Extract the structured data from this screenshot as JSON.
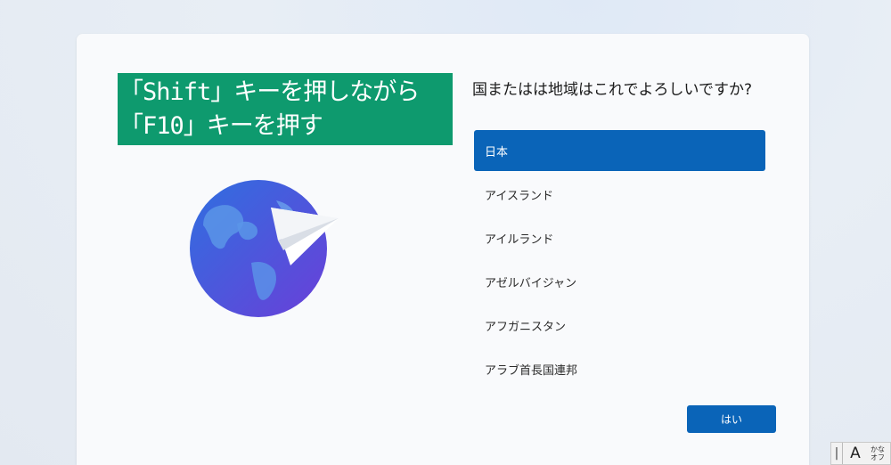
{
  "banner": {
    "line1": "「Shift」キーを押しながら",
    "line2": "「F10」キーを押す"
  },
  "question": "国またはは地域はこれでよろしいですか?",
  "regions": [
    {
      "label": "日本",
      "selected": true
    },
    {
      "label": "アイスランド",
      "selected": false
    },
    {
      "label": "アイルランド",
      "selected": false
    },
    {
      "label": "アゼルバイジャン",
      "selected": false
    },
    {
      "label": "アフガニスタン",
      "selected": false
    },
    {
      "label": "アラブ首長国連邦",
      "selected": false
    }
  ],
  "yes_button": "はい",
  "ime": {
    "mode": "A",
    "kana": "かな\nオフ"
  },
  "colors": {
    "accent": "#0a64b8",
    "banner": "#0e9a6e"
  }
}
